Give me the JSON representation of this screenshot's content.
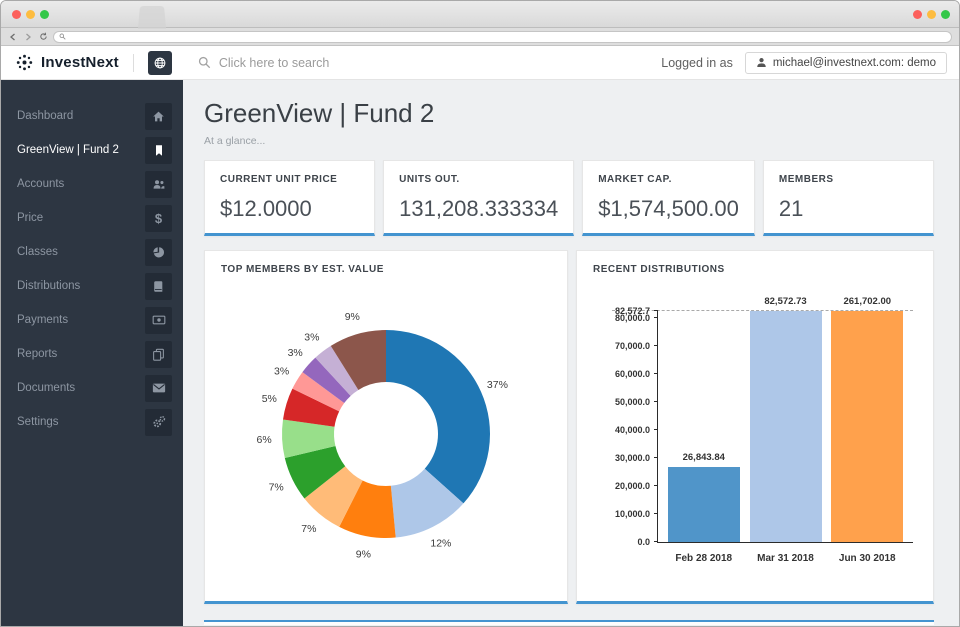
{
  "browser": {
    "traffic_lights": [
      "#fc605c",
      "#fdbc40",
      "#34c749"
    ],
    "url_value": ""
  },
  "topbar": {
    "brand": "InvestNext",
    "search_text": "Click here to search",
    "logged_in_as": "Logged in as",
    "user": "michael@investnext.com: demo"
  },
  "sidebar": {
    "items": [
      {
        "label": "Dashboard",
        "icon": "home-icon",
        "active": false
      },
      {
        "label": "GreenView | Fund 2",
        "icon": "bookmark-icon",
        "active": true
      },
      {
        "label": "Accounts",
        "icon": "users-icon",
        "active": false
      },
      {
        "label": "Price",
        "icon": "dollar-icon",
        "active": false
      },
      {
        "label": "Classes",
        "icon": "pie-chart-icon",
        "active": false
      },
      {
        "label": "Distributions",
        "icon": "book-icon",
        "active": false
      },
      {
        "label": "Payments",
        "icon": "money-icon",
        "active": false
      },
      {
        "label": "Reports",
        "icon": "copy-icon",
        "active": false
      },
      {
        "label": "Documents",
        "icon": "envelope-icon",
        "active": false
      },
      {
        "label": "Settings",
        "icon": "gears-icon",
        "active": false
      }
    ]
  },
  "main": {
    "title": "GreenView | Fund 2",
    "subtitle": "At a glance...",
    "accent_color": "#4394d0",
    "stats": [
      {
        "label": "CURRENT UNIT PRICE",
        "value": "$12.0000"
      },
      {
        "label": "UNITS OUT.",
        "value": "131,208.333334"
      },
      {
        "label": "MARKET CAP.",
        "value": "$1,574,500.00"
      },
      {
        "label": "MEMBERS",
        "value": "21"
      }
    ]
  },
  "chart_data": [
    {
      "type": "pie",
      "title": "TOP MEMBERS BY EST. VALUE",
      "donut": true,
      "values": [
        37,
        12,
        9,
        7,
        7,
        6,
        5,
        3,
        3,
        3,
        9
      ],
      "labels": [
        "37%",
        "12%",
        "9%",
        "7%",
        "7%",
        "6%",
        "5%",
        "3%",
        "3%",
        "3%",
        "9%"
      ],
      "colors": [
        "#1f77b4",
        "#aec7e8",
        "#ff7f0e",
        "#ffbb78",
        "#2ca02c",
        "#98df8a",
        "#d62728",
        "#ff9896",
        "#9467bd",
        "#c5b0d5",
        "#8c564b"
      ],
      "start_angle_deg": 0,
      "direction": "clockwise",
      "legend": "none"
    },
    {
      "type": "bar",
      "title": "RECENT DISTRIBUTIONS",
      "categories": [
        "Feb 28 2018",
        "Mar 31 2018",
        "Jun 30 2018"
      ],
      "values": [
        26843.84,
        82572.73,
        261702.0
      ],
      "bar_labels": [
        "26,843.84",
        "82,572.73",
        "261,702.00"
      ],
      "colors": [
        "#5095c9",
        "#aec7e8",
        "#ffa14c"
      ],
      "y_ticks": [
        "0.0",
        "10,000.0",
        "20,000.0",
        "30,000.0",
        "40,000.0",
        "50,000.0",
        "60,000.0",
        "70,000.0",
        "80,000.0",
        "82,572.7"
      ],
      "y_tick_values": [
        0,
        10000,
        20000,
        30000,
        40000,
        50000,
        60000,
        70000,
        80000,
        82572.7
      ],
      "ylim": [
        0,
        82572.7
      ],
      "clip_to_ylim": true,
      "grid": "off",
      "legend": "none"
    }
  ]
}
